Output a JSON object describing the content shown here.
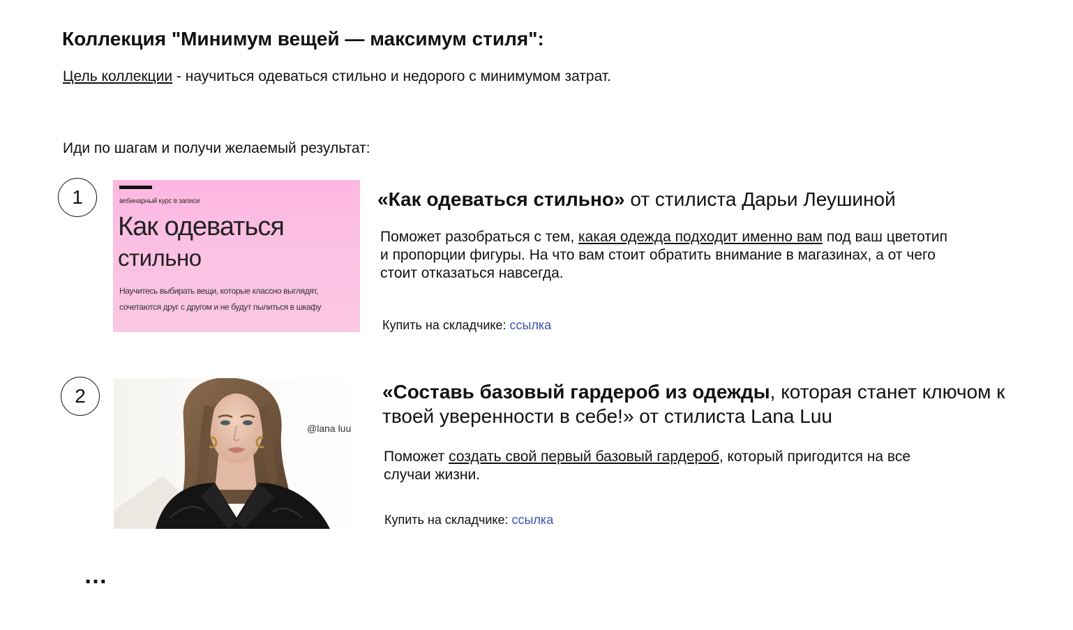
{
  "title": "Коллекция \"Минимум вещей — максимум стиля\":",
  "goal": {
    "label": "Цель коллекции",
    "text": " - научиться одеваться стильно и недорого с минимумом затрат."
  },
  "steps_intro": "Иди по шагам и получи желаемый результат:",
  "steps": [
    {
      "number": "1",
      "image": {
        "kicker": "вебинарный курс в записи",
        "title_line1": "Как одеваться",
        "title_line2": "стильно",
        "caption": "Научитесь выбирать вещи, которые классно выглядят, сочетаются друг с другом и не будут пылиться в шкафу",
        "bg_color": "#fdbde3"
      },
      "heading_bold": "«Как одеваться стильно»",
      "heading_rest": " от стилиста Дарьи Леушиной",
      "desc_before": "Поможет разобраться с тем, ",
      "desc_link": "какая одежда подходит именно вам",
      "desc_after": " под ваш цветотип и пропорции фигуры.  На что вам стоит обратить внимание в магазинах, а от чего стоит отказаться навсегда.",
      "buy_label": "Купить на складчике: ",
      "buy_link": "ссылка"
    },
    {
      "number": "2",
      "image": {
        "watermark": "@lana luu"
      },
      "heading_bold": "«Составь базовый гардероб из одежды",
      "heading_rest": ", которая станет ключом к твоей уверенности в себе!» от стилиста Lana Luu",
      "desc_before": "Поможет ",
      "desc_link": "создать свой первый базовый гардероб",
      "desc_after": ", который пригодится на все случаи жизни.",
      "buy_label": "Купить на складчике: ",
      "buy_link": "ссылка"
    }
  ],
  "ellipsis": "…",
  "colors": {
    "link": "#3f52b5",
    "text": "#111111",
    "pink_banner": "#fdbde3"
  }
}
